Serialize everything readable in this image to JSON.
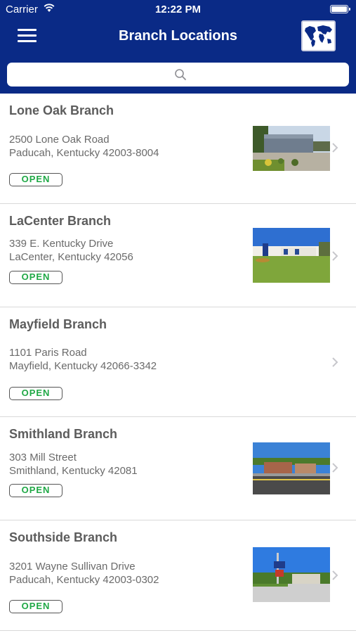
{
  "status_bar": {
    "carrier": "Carrier",
    "time": "12:22 PM"
  },
  "nav": {
    "title": "Branch Locations",
    "menu_icon": "hamburger-menu-icon",
    "map_icon": "world-map-icon"
  },
  "search": {
    "placeholder": "",
    "icon": "search-icon"
  },
  "colors": {
    "header_bg": "#0a2a86",
    "open_text": "#1fa845",
    "branch_name": "#5c5c5c"
  },
  "branches": [
    {
      "name": "Lone Oak Branch",
      "address_line1": "2500 Lone Oak Road",
      "address_line2": "Paducah, Kentucky 42003-8004",
      "status": "OPEN",
      "has_photo": true
    },
    {
      "name": "LaCenter Branch",
      "address_line1": "339 E. Kentucky Drive",
      "address_line2": "LaCenter, Kentucky 42056",
      "status": "OPEN",
      "has_photo": true
    },
    {
      "name": "Mayfield Branch",
      "address_line1": "1101 Paris Road",
      "address_line2": "Mayfield, Kentucky 42066-3342",
      "status": "OPEN",
      "has_photo": false
    },
    {
      "name": "Smithland Branch",
      "address_line1": "303 Mill Street",
      "address_line2": "Smithland, Kentucky 42081",
      "status": "OPEN",
      "has_photo": true
    },
    {
      "name": "Southside Branch",
      "address_line1": "3201 Wayne Sullivan Drive",
      "address_line2": "Paducah, Kentucky 42003-0302",
      "status": "OPEN",
      "has_photo": true
    }
  ]
}
